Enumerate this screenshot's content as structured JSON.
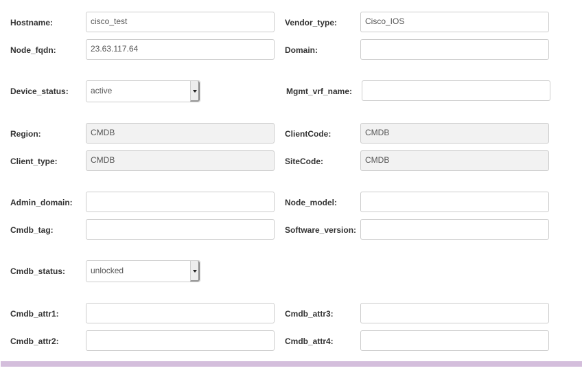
{
  "fields": {
    "hostname": {
      "label": "Hostname:",
      "value": "cisco_test"
    },
    "vendor_type": {
      "label": "Vendor_type:",
      "value": "Cisco_IOS"
    },
    "node_fqdn": {
      "label": "Node_fqdn:",
      "value": "23.63.117.64"
    },
    "domain": {
      "label": "Domain:",
      "value": ""
    },
    "device_status": {
      "label": "Device_status:",
      "value": "active"
    },
    "mgmt_vrf_name": {
      "label": "Mgmt_vrf_name:",
      "value": ""
    },
    "region": {
      "label": "Region:",
      "value": "CMDB"
    },
    "client_code": {
      "label": "ClientCode:",
      "value": "CMDB"
    },
    "client_type": {
      "label": "Client_type:",
      "value": "CMDB"
    },
    "site_code": {
      "label": "SiteCode:",
      "value": "CMDB"
    },
    "admin_domain": {
      "label": "Admin_domain:",
      "value": ""
    },
    "node_model": {
      "label": "Node_model:",
      "value": ""
    },
    "cmdb_tag": {
      "label": "Cmdb_tag:",
      "value": ""
    },
    "software_version": {
      "label": "Software_version:",
      "value": ""
    },
    "cmdb_status": {
      "label": "Cmdb_status:",
      "value": "unlocked"
    },
    "cmdb_attr1": {
      "label": "Cmdb_attr1:",
      "value": ""
    },
    "cmdb_attr3": {
      "label": "Cmdb_attr3:",
      "value": ""
    },
    "cmdb_attr2": {
      "label": "Cmdb_attr2:",
      "value": ""
    },
    "cmdb_attr4": {
      "label": "Cmdb_attr4:",
      "value": ""
    }
  },
  "colors": {
    "footer_bar": "#d4bedc",
    "readonly_bg": "#f2f2f2"
  }
}
